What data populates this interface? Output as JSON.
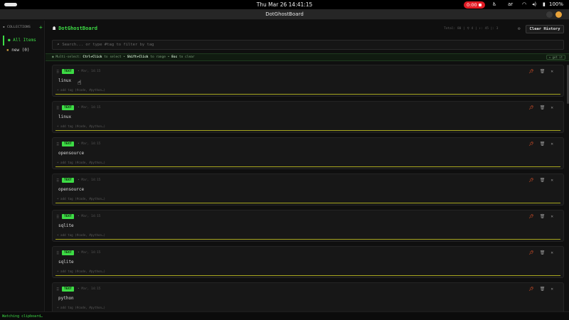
{
  "system": {
    "clock": "Thu Mar 26  14:41:15",
    "recording": "0:00",
    "language": "ar",
    "battery": "100%"
  },
  "window": {
    "title": "DotGhostBoard"
  },
  "sidebar": {
    "heading": "COLLECTIONS",
    "add_icon": "plus-icon",
    "items": [
      {
        "label": "All Items",
        "active": true
      },
      {
        "label": "new (0)",
        "active": false
      }
    ]
  },
  "header": {
    "brand": "DotGhostBoard",
    "stats": "Total: 80  |  ⚲ 4  |  ↑: 45  |: 3",
    "clear_label": "Clear History"
  },
  "search": {
    "placeholder": "Search... or type #tag to filter by tag"
  },
  "hint": {
    "prefix": "Multi-select:",
    "k1": "Ctrl+Click",
    "t1": "to select •",
    "k2": "Shift+Click",
    "t2": "to range •",
    "k3": "Esc",
    "t3": "to clear",
    "got_it": "✕ got it"
  },
  "cards": [
    {
      "type": "TEXT",
      "time": "• Mar, 14:15",
      "content": "linux",
      "tag": "+ add tag  (#code, #python…)"
    },
    {
      "type": "TEXT",
      "time": "• Mar, 14:15",
      "content": "linux",
      "tag": "+ add tag  (#code, #python…)"
    },
    {
      "type": "TEXT",
      "time": "• Mar, 14:15",
      "content": "opensource",
      "tag": "+ add tag  (#code, #python…)"
    },
    {
      "type": "TEXT",
      "time": "• Mar, 14:15",
      "content": "opensource",
      "tag": "+ add tag  (#code, #python…)"
    },
    {
      "type": "TEXT",
      "time": "• Mar, 14:15",
      "content": "sqlite",
      "tag": "+ add tag  (#code, #python…)"
    },
    {
      "type": "TEXT",
      "time": "• Mar, 14:15",
      "content": "sqlite",
      "tag": "+ add tag  (#code, #python…)"
    },
    {
      "type": "TEXT",
      "time": "• Mar, 14:15",
      "content": "python",
      "tag": "+ add tag  (#code, #python…)"
    }
  ],
  "status": "Watching clipboard…",
  "colors": {
    "accent": "#3ddc45",
    "underline": "#a6a51f",
    "pin": "#e8552a"
  }
}
